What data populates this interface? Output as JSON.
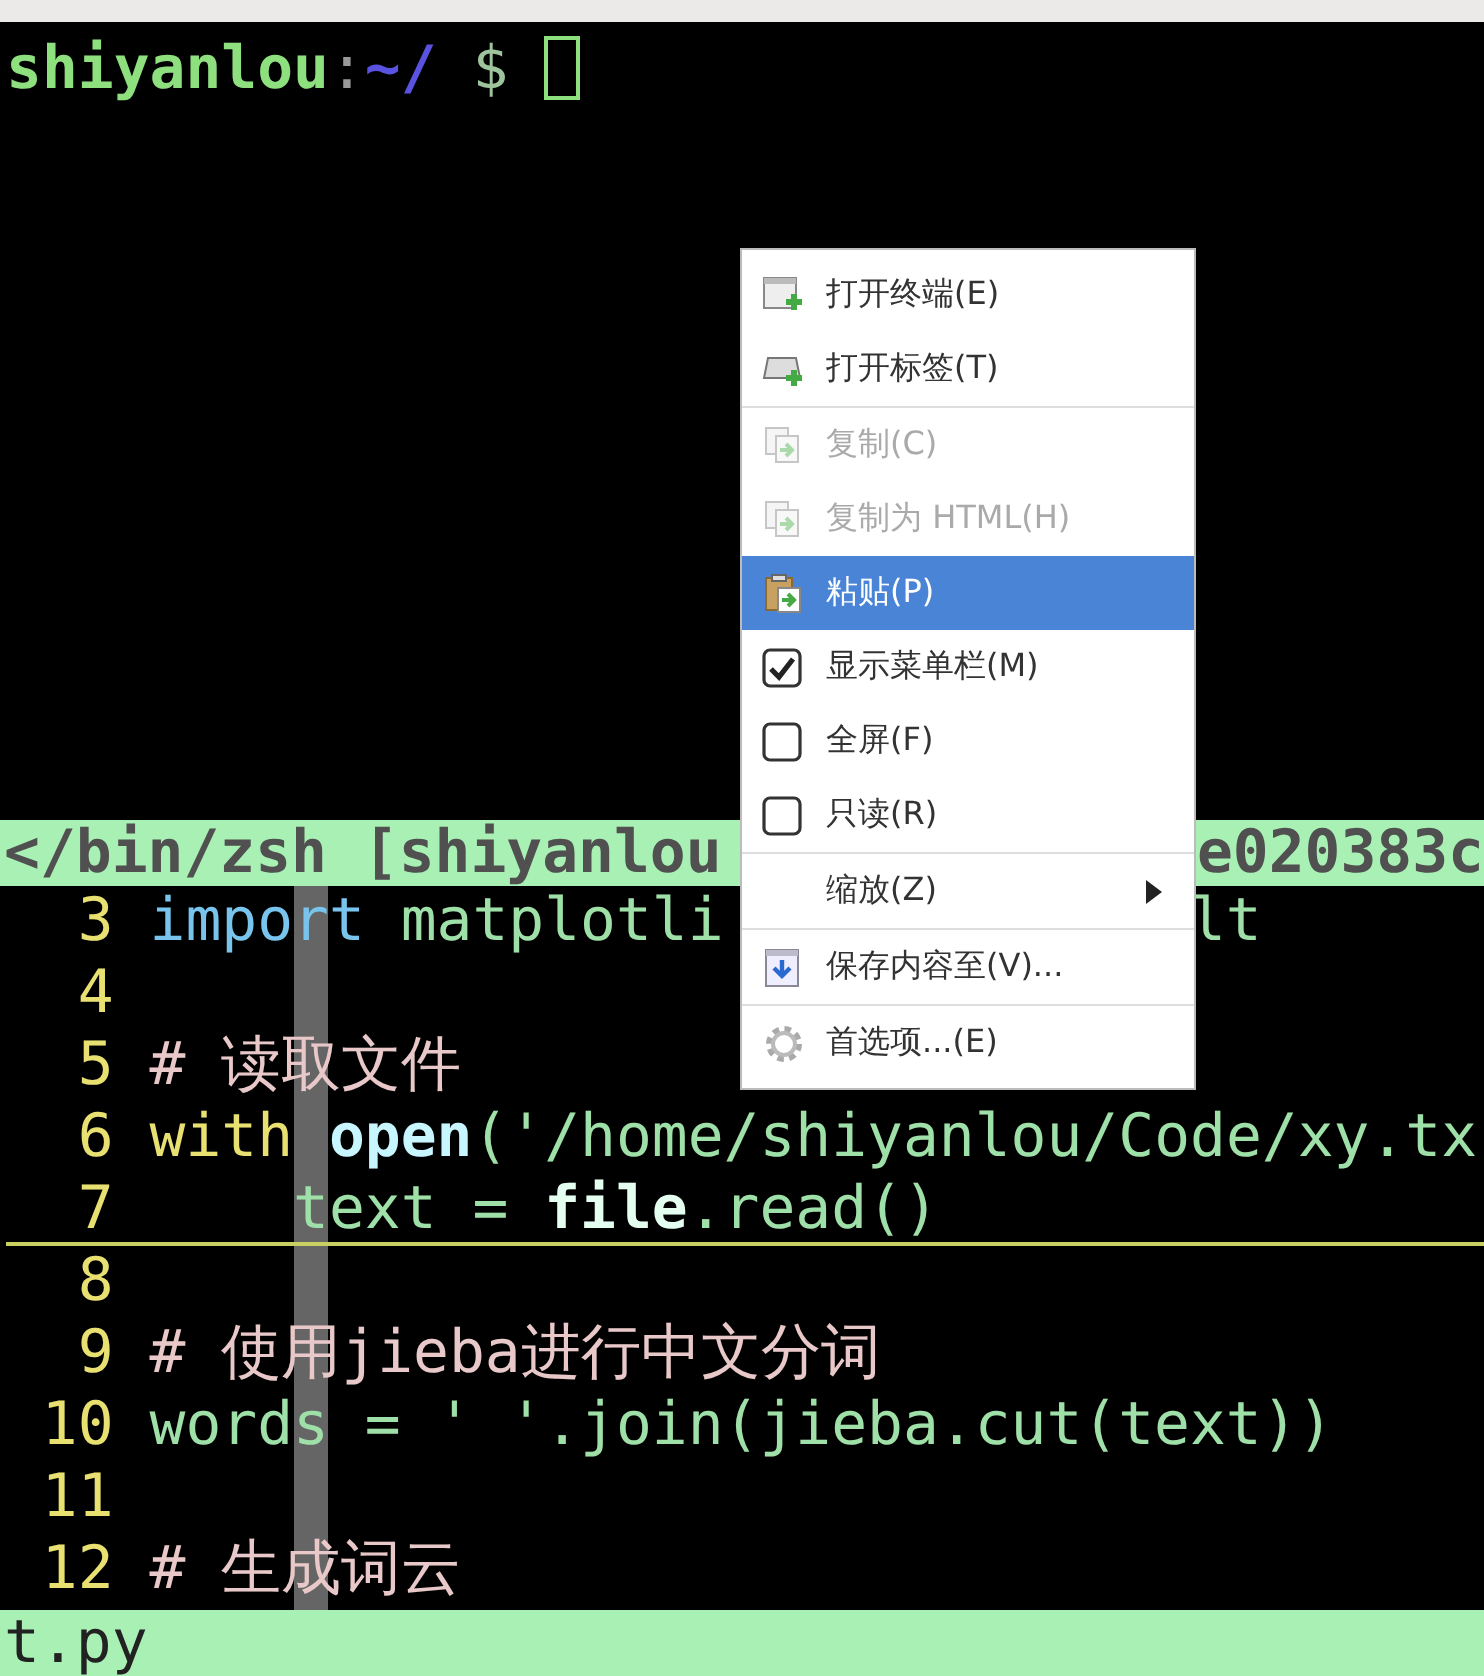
{
  "prompt": {
    "user": "shiyanlou",
    "sep": ":",
    "path": "~/",
    "symbol": "$"
  },
  "status_bar": {
    "left": "</bin/zsh [shiyanlou",
    "right": "e020383c"
  },
  "code_lines": [
    {
      "number": "3",
      "current": false,
      "tokens": [
        {
          "kind": "keyword",
          "text": "import"
        },
        {
          "kind": "plain",
          "text": " matplotli"
        }
      ],
      "tail": "lt"
    },
    {
      "number": "4",
      "current": false
    },
    {
      "number": "5",
      "current": false,
      "tokens": [
        {
          "kind": "comment",
          "text": "# 读取文件"
        }
      ]
    },
    {
      "number": "6",
      "current": false,
      "tokens": [
        {
          "kind": "builtin",
          "text": "with"
        },
        {
          "kind": "function",
          "text": "open"
        },
        {
          "kind": "plain",
          "text": "('/home/shiyanlou/Code/xy.tx"
        }
      ]
    },
    {
      "number": "7",
      "current": true,
      "tokens": [
        {
          "kind": "plain",
          "text": "    text = "
        },
        {
          "kind": "variable",
          "text": "file"
        },
        {
          "kind": "plain",
          "text": ".read()"
        }
      ]
    },
    {
      "number": "8",
      "current": false
    },
    {
      "number": "9",
      "current": false,
      "tokens": [
        {
          "kind": "comment",
          "text": "# 使用jieba进行中文分词"
        }
      ]
    },
    {
      "number": "10",
      "current": false,
      "tokens": [
        {
          "kind": "plain",
          "text": "words = ' '.join(jieba.cut(text))"
        }
      ]
    },
    {
      "number": "11",
      "current": false
    },
    {
      "number": "12",
      "current": false,
      "tokens": [
        {
          "kind": "comment",
          "text": "# 生成词云"
        }
      ]
    }
  ],
  "file_bar": "t.py",
  "context_menu": [
    {
      "kind": "action",
      "label": "打开终端(E)",
      "disabled": false,
      "selected": false
    },
    {
      "kind": "action",
      "label": "打开标签(T)",
      "disabled": false,
      "selected": false
    },
    {
      "kind": "separator"
    },
    {
      "kind": "action",
      "label": "复制(C)",
      "disabled": true,
      "selected": false
    },
    {
      "kind": "action",
      "label": "复制为 HTML(H)",
      "disabled": true,
      "selected": false
    },
    {
      "kind": "action",
      "label": "粘贴(P)",
      "disabled": false,
      "selected": true
    },
    {
      "kind": "check",
      "label": "显示菜单栏(M)",
      "checked": true,
      "selected": false
    },
    {
      "kind": "check",
      "label": "全屏(F)",
      "checked": false,
      "selected": false
    },
    {
      "kind": "check",
      "label": "只读(R)",
      "checked": false,
      "selected": false
    },
    {
      "kind": "separator"
    },
    {
      "kind": "submenu",
      "label": "缩放(Z)",
      "selected": false
    },
    {
      "kind": "separator"
    },
    {
      "kind": "action",
      "label": "保存内容至(V)...",
      "disabled": false,
      "selected": false
    },
    {
      "kind": "separator"
    },
    {
      "kind": "action",
      "label": "首选项...(E)",
      "disabled": false,
      "selected": false
    }
  ]
}
